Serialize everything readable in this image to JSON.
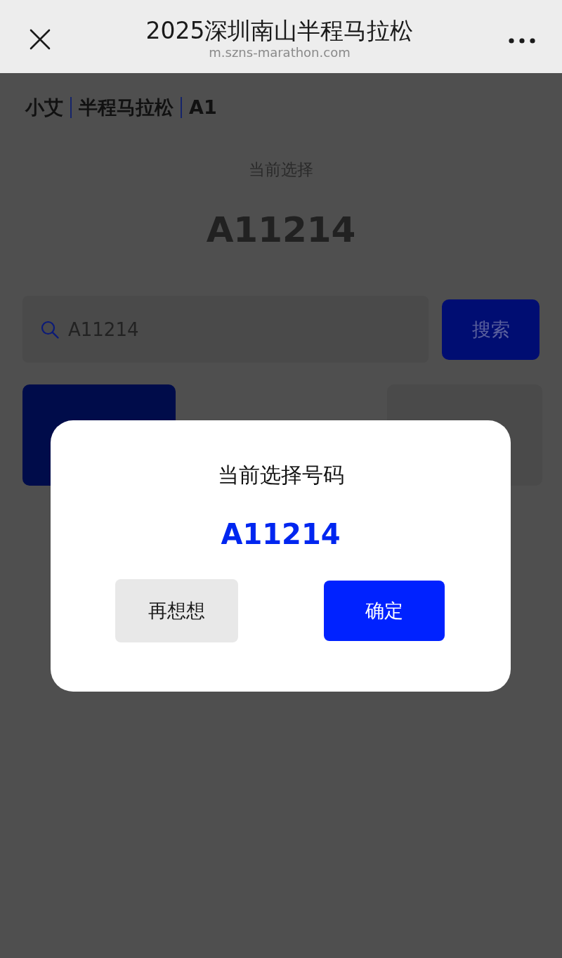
{
  "top_bar": {
    "title": "2025深圳南山半程马拉松",
    "url": "m.szns-marathon.com"
  },
  "breadcrumb": [
    "小艾",
    "半程马拉松",
    "A1"
  ],
  "current": {
    "label": "当前选择",
    "number": "A11214"
  },
  "search": {
    "value": "A11214",
    "button": "搜索"
  },
  "dialog": {
    "title": "当前选择号码",
    "number": "A11214",
    "buttons": [
      {
        "label": "再想想",
        "kind": "secondary"
      },
      {
        "label": "确定",
        "kind": "primary"
      }
    ]
  }
}
